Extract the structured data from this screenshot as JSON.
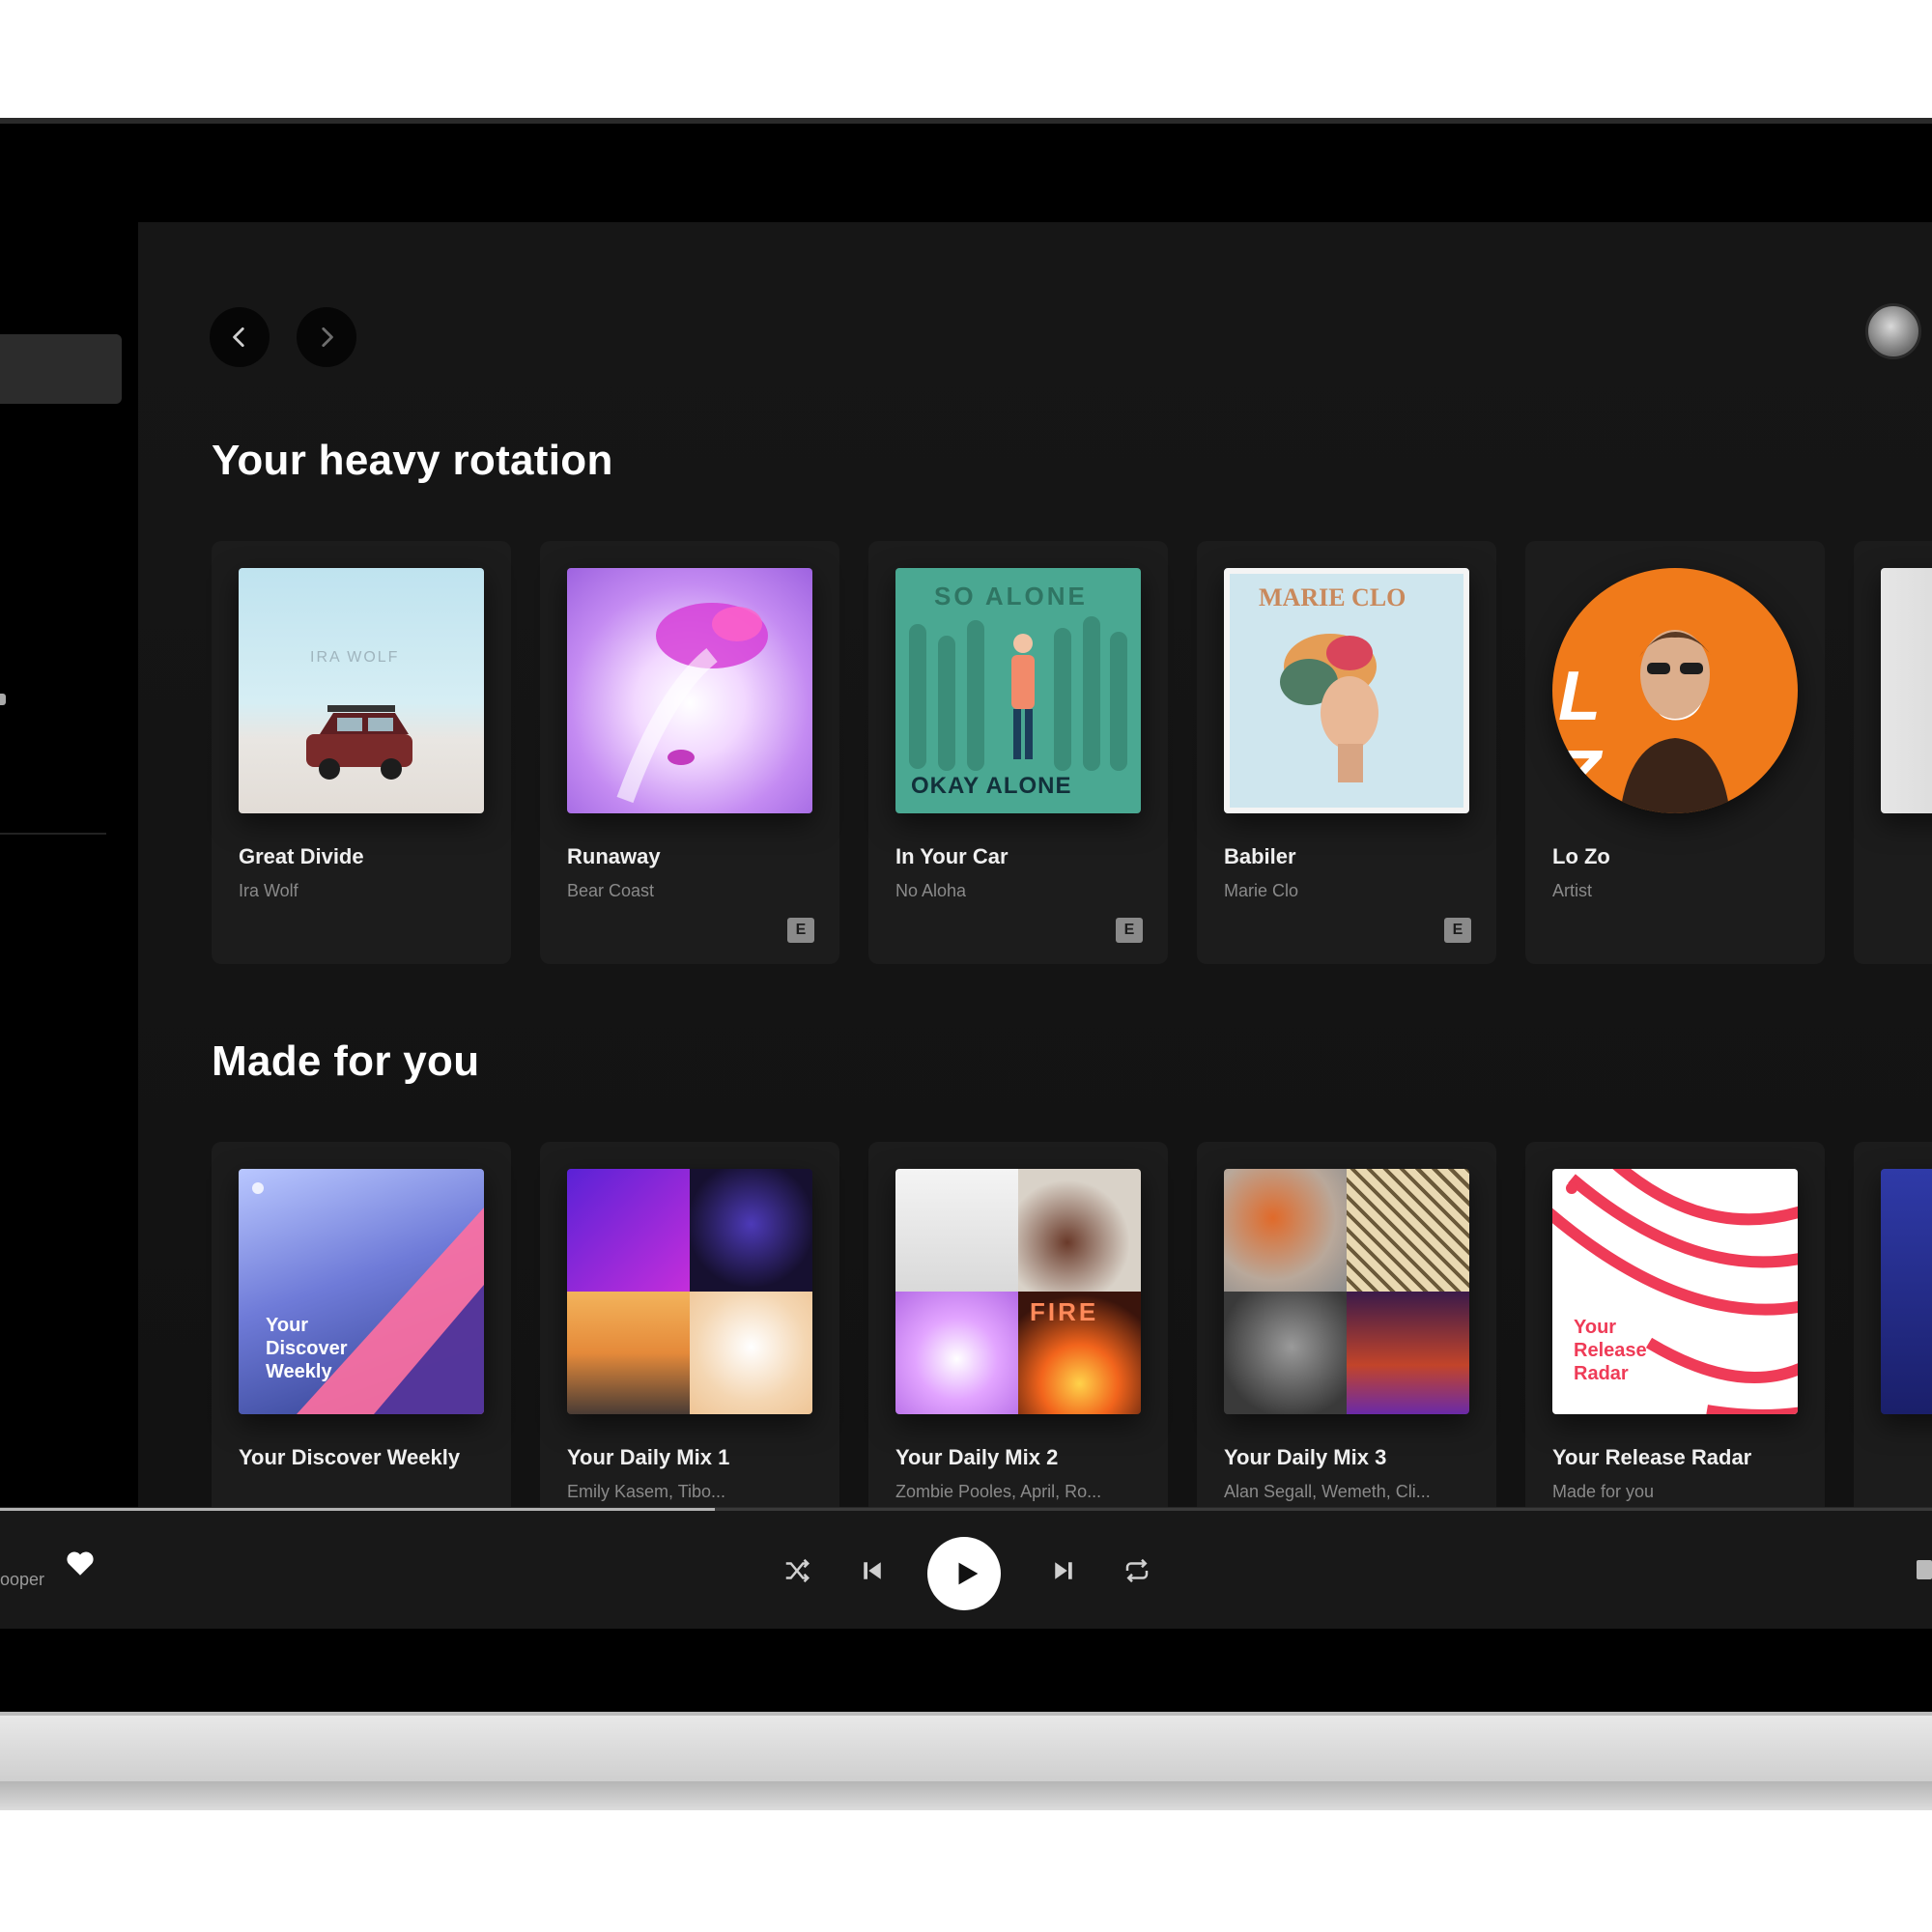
{
  "colors": {
    "background": "#121212",
    "card": "#1c1c1c",
    "text_primary": "#f0f0f0",
    "text_secondary": "#8a8a8a"
  },
  "sections": [
    {
      "title": "Your heavy rotation",
      "cards": [
        {
          "title": "Great Divide",
          "subtitle": "Ira Wolf",
          "explicit": false,
          "art": "desert-car"
        },
        {
          "title": "Runaway",
          "subtitle": "Bear Coast",
          "explicit": true,
          "art": "purple-smoke"
        },
        {
          "title": "In Your Car",
          "subtitle": "No Aloha",
          "explicit": true,
          "art": "so-alone"
        },
        {
          "title": "Babiler",
          "subtitle": "Marie Clo",
          "explicit": true,
          "art": "marie-clo"
        },
        {
          "title": "Lo Zo",
          "subtitle": "Artist",
          "explicit": false,
          "art": "orange-portrait",
          "round": true
        }
      ]
    },
    {
      "title": "Made for you",
      "cards": [
        {
          "title": "Your Discover Weekly",
          "subtitle": "",
          "art": "discover-weekly",
          "art_text": "Your Discover Weekly"
        },
        {
          "title": "Your Daily Mix 1",
          "subtitle": "Emily Kasem, Tibo...",
          "art": "mix1"
        },
        {
          "title": "Your Daily Mix 2",
          "subtitle": "Zombie Pooles, April, Ro...",
          "art": "mix2"
        },
        {
          "title": "Your Daily Mix 3",
          "subtitle": "Alan Segall, Wemeth, Cli...",
          "art": "mix3"
        },
        {
          "title": "Your Release Radar",
          "subtitle": "Made for you",
          "art": "release-radar",
          "art_text": "Your Release Radar"
        }
      ]
    }
  ],
  "art_labels": {
    "so_alone_top": "SO ALONE",
    "so_alone_bottom": "OKAY ALONE",
    "marie_clo": "MARIE CLO",
    "lozo": "LO ZO",
    "ira_wolf": "IRA WOLF",
    "fire": "FIRE"
  },
  "player": {
    "artist_partial": "ooper",
    "progress": 0.37,
    "controls": [
      "shuffle",
      "previous",
      "play",
      "next",
      "repeat"
    ]
  }
}
